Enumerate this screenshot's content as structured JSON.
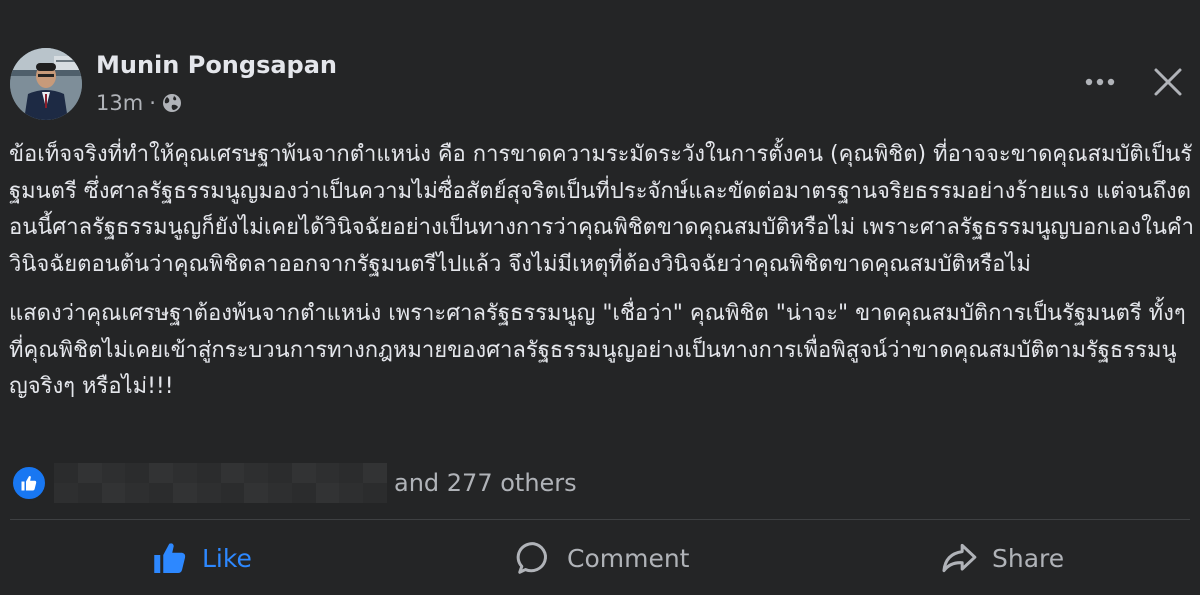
{
  "post": {
    "author": "Munin Pongsapan",
    "time": "13m",
    "separator": "·",
    "privacy_icon": "globe-icon",
    "paragraphs": [
      "ข้อเท็จจริงที่ทำให้คุณเศรษฐาพ้นจากตำแหน่ง คือ การขาดความระมัดระวังในการตั้งคน (คุณพิชิต) ที่อาจจะขาดคุณสมบัติเป็นรัฐมนตรี ซึ่งศาลรัฐธรรมนูญมองว่าเป็นความไม่ซื่อสัตย์สุจริตเป็นที่ประจักษ์และขัดต่อมาตรฐานจริยธรรมอย่างร้ายแรง แต่จนถึงตอนนี้ศาลรัฐธรรมนูญก็ยังไม่เคยได้วินิจฉัยอย่างเป็นทางการว่าคุณพิชิตขาดคุณสมบัติหรือไม่ เพราะศาลรัฐธรรมนูญบอกเองในคำวินิจฉัยตอนต้นว่าคุณพิชิตลาออกจากรัฐมนตรีไปแล้ว จึงไม่มีเหตุที่ต้องวินิจฉัยว่าคุณพิชิตขาดคุณสมบัติหรือไม่",
      "แสดงว่าคุณเศรษฐาต้องพ้นจากตำแหน่ง เพราะศาลรัฐธรรมนูญ \"เชื่อว่า\" คุณพิชิต \"น่าจะ\" ขาดคุณสมบัติการเป็นรัฐมนตรี ทั้งๆ ที่คุณพิชิตไม่เคยเข้าสู่กระบวนการทางกฎหมายของศาลรัฐธรรมนูญอย่างเป็นทางการเพื่อพิสูจน์ว่าขาดคุณสมบัติตามรัฐธรรมนูญจริงๆ หรือไม่!!!"
    ]
  },
  "reactions": {
    "others_text": "and 277 others",
    "reaction_icon": "like-reaction-icon"
  },
  "actions": {
    "like": "Like",
    "comment": "Comment",
    "share": "Share"
  },
  "colors": {
    "background": "#242526",
    "text_primary": "#e4e6eb",
    "text_secondary": "#b0b3b8",
    "like_blue": "#2d88ff",
    "badge_blue": "#1877f2"
  }
}
